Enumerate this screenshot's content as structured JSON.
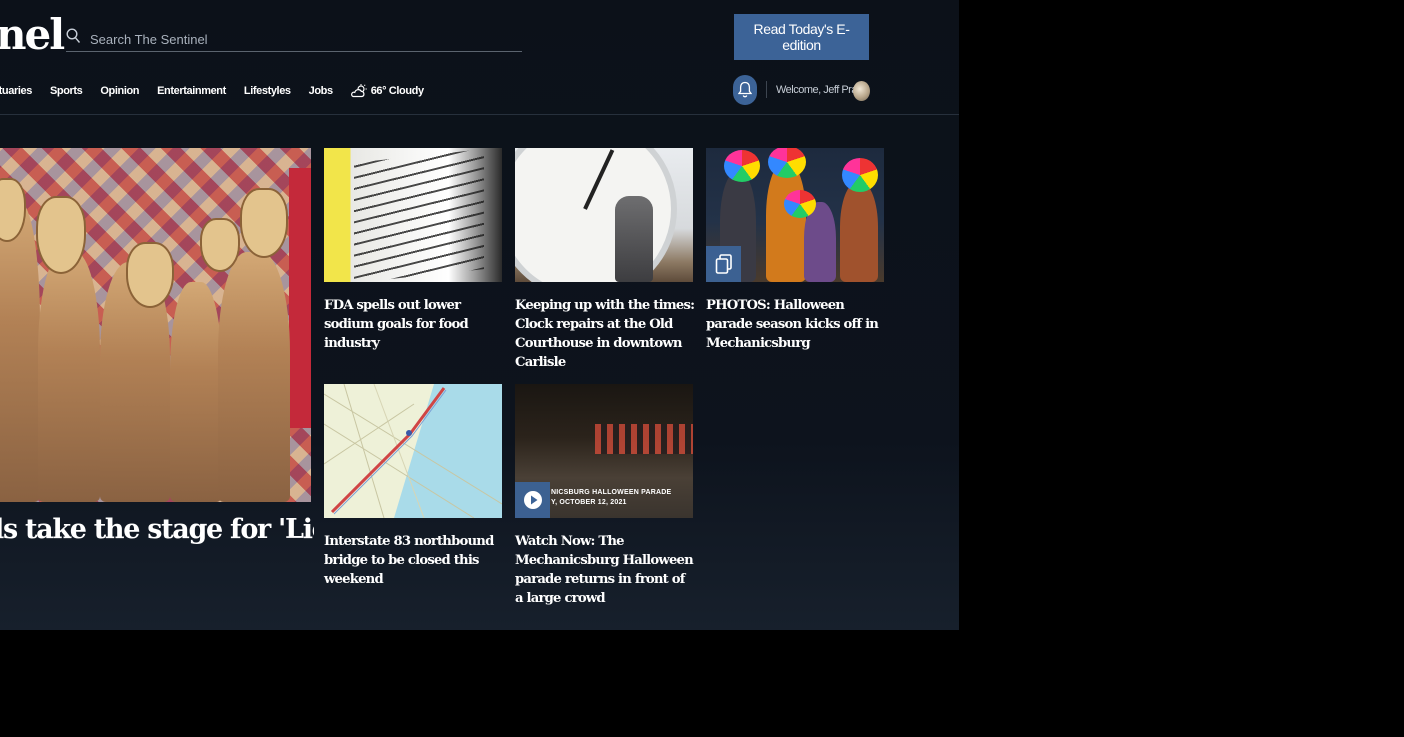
{
  "header": {
    "logo_text": "nel",
    "search_placeholder": "Search The Sentinel",
    "eedition_label": "Read Today's E-edition",
    "welcome_text": "Welcome, Jeff Pratt"
  },
  "nav": {
    "items": [
      "ituaries",
      "Sports",
      "Opinion",
      "Entertainment",
      "Lifestyles",
      "Jobs"
    ],
    "weather": "66° Cloudy"
  },
  "hero": {
    "title": "ls take the stage for 'Lion King"
  },
  "stories": [
    {
      "headline": "FDA spells out lower sodium goals for food industry",
      "image": "nutrition-label-photo"
    },
    {
      "headline": "Keeping up with the times: Clock repairs at the Old Courthouse in downtown Carlisle",
      "image": "clock-repair-photo"
    },
    {
      "headline": "PHOTOS: Halloween parade season kicks off in Mechanicsburg",
      "image": "halloween-clowns-photo",
      "badge_icon": "gallery-icon"
    },
    {
      "headline": "Interstate 83 northbound bridge to be closed this weekend",
      "image": "map-image"
    },
    {
      "headline": "Watch Now: The Mechanicsburg Halloween parade returns in front of a large crowd",
      "image": "parade-night-video",
      "badge_icon": "play-icon",
      "caption_line1": "NICSBURG HALLOWEEN PARADE",
      "caption_line2": "Y, OCTOBER 12, 2021"
    }
  ],
  "colors": {
    "background": "#0d131d",
    "accent": "#3c6397",
    "text": "#ffffff"
  }
}
